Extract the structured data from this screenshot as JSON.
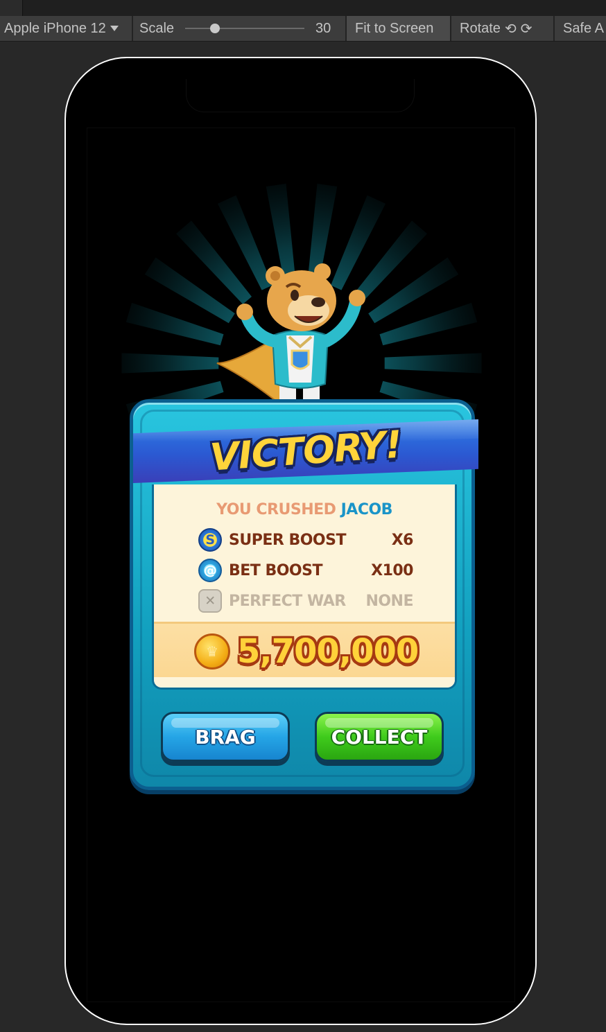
{
  "toolbar": {
    "device_label": "Apple iPhone 12",
    "scale_label": "Scale",
    "scale_value": "30",
    "fit_label": "Fit to Screen",
    "rotate_label": "Rotate",
    "safe_label": "Safe A",
    "icons": [
      "chevron-down-icon",
      "rotate-left-icon",
      "rotate-right-icon"
    ]
  },
  "game": {
    "title": "VICTORY!",
    "crushed_prefix": "YOU CRUSHED",
    "opponent": "JACOB",
    "boosts": [
      {
        "icon": "super-boost-icon",
        "label": "SUPER BOOST",
        "value": "X6",
        "active": true
      },
      {
        "icon": "bet-boost-icon",
        "label": "BET BOOST",
        "value": "X100",
        "active": true
      },
      {
        "icon": "perfect-war-icon",
        "label": "PERFECT WAR",
        "value": "NONE",
        "active": false
      }
    ],
    "reward_amount": "5,700,000",
    "reward_icon": "coin-icon",
    "brag_label": "BRAG",
    "collect_label": "COLLECT"
  },
  "colors": {
    "panel": "#1aa8c8",
    "ribbon": "#2b59d2",
    "title": "#ffd43a",
    "card": "#fdf4da",
    "brag": "#25a5e6",
    "collect": "#3fcb1c"
  }
}
